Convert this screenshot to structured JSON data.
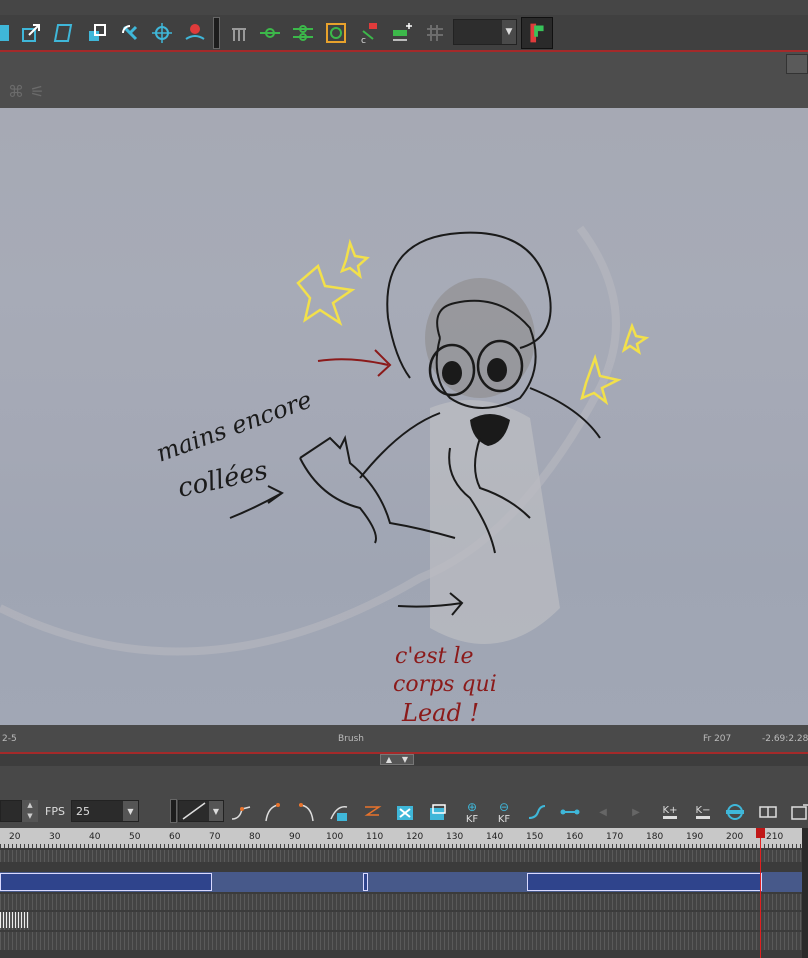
{
  "toolbar": {
    "icons": [
      "move-icon",
      "scale-icon",
      "skew-icon",
      "transform-icon",
      "rotate-icon",
      "pivot-icon",
      "deform-icon",
      "separator",
      "hand-icon",
      "curve-point-icon",
      "bone-chain-icon",
      "envelope-icon",
      "color-picker-icon",
      "add-keyframe-icon",
      "grid-icon",
      "dropdown",
      "green-flag-icon"
    ],
    "dropdown_value": ""
  },
  "status": {
    "left": "2-5",
    "tool": "Brush",
    "frame": "Fr 207",
    "coords": "-2.69:2.28"
  },
  "drawing": {
    "annotation_left_line1": "mains encore",
    "annotation_left_line2": "collées",
    "annotation_bottom_line1": "c'est le",
    "annotation_bottom_line2": "corps qui",
    "annotation_bottom_line3": "Lead !",
    "ink_black": "#1a1a1a",
    "ink_red": "#8b1a1a",
    "ink_yellow": "#f2e04a"
  },
  "timeline": {
    "frame_value": "",
    "fps_label": "FPS",
    "fps_value": "25",
    "buttons": [
      "ease-in-icon",
      "ease-out-icon",
      "ease-in-out-icon",
      "set-key-icon",
      "motion-icon",
      "add-drawing-icon",
      "clone-icon",
      "add-keyframe-icon",
      "remove-keyframe-icon",
      "linear-icon",
      "hold-icon",
      "prev-keyframe-icon",
      "next-keyframe-icon",
      "add-key-icon",
      "remove-key-icon",
      "onion-skin-icon",
      "split-view-icon",
      "expand-icon"
    ],
    "kf_label": "KF",
    "k_plus": "K+",
    "k_minus": "K−",
    "ruler": [
      "20",
      "30",
      "40",
      "50",
      "60",
      "70",
      "80",
      "90",
      "100",
      "110",
      "120",
      "130",
      "140",
      "150",
      "160",
      "170",
      "180",
      "190",
      "200",
      "210"
    ],
    "playhead_frame": 207
  },
  "colors": {
    "accent_red": "#a42a2a",
    "track_blue": "#2f448c"
  }
}
